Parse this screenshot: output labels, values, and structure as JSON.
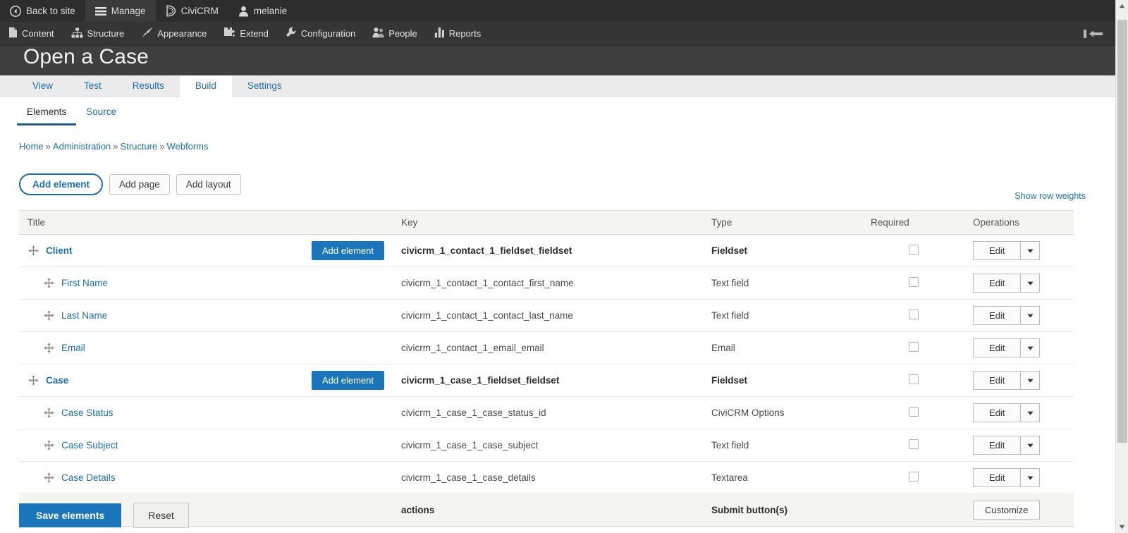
{
  "toolbar": {
    "tabs": [
      {
        "label": "Back to site",
        "icon": "back-arrow-icon",
        "active": false
      },
      {
        "label": "Manage",
        "icon": "hamburger-icon",
        "active": true
      },
      {
        "label": "CiviCRM",
        "icon": "civicrm-icon",
        "active": false
      },
      {
        "label": "melanie",
        "icon": "user-icon",
        "active": false
      }
    ],
    "tray_items": [
      {
        "label": "Content",
        "icon": "file-icon"
      },
      {
        "label": "Structure",
        "icon": "structure-icon"
      },
      {
        "label": "Appearance",
        "icon": "paintbrush-icon"
      },
      {
        "label": "Extend",
        "icon": "puzzle-icon"
      },
      {
        "label": "Configuration",
        "icon": "wrench-icon"
      },
      {
        "label": "People",
        "icon": "people-icon"
      },
      {
        "label": "Reports",
        "icon": "bar-chart-icon"
      }
    ],
    "collapse_icon": "collapse-toolbar-icon"
  },
  "page": {
    "title": "Open a Case"
  },
  "primary_tabs": [
    {
      "label": "View",
      "active": false
    },
    {
      "label": "Test",
      "active": false
    },
    {
      "label": "Results",
      "active": false
    },
    {
      "label": "Build",
      "active": true
    },
    {
      "label": "Settings",
      "active": false
    }
  ],
  "secondary_tabs": [
    {
      "label": "Elements",
      "active": true
    },
    {
      "label": "Source",
      "active": false
    }
  ],
  "breadcrumb": [
    {
      "label": "Home"
    },
    {
      "label": "Administration"
    },
    {
      "label": "Structure"
    },
    {
      "label": "Webforms"
    }
  ],
  "breadcrumb_separator": "»",
  "actions": {
    "add_element": "Add element",
    "add_page": "Add page",
    "add_layout": "Add layout",
    "show_row_weights": "Show row weights",
    "save_elements": "Save elements",
    "reset": "Reset"
  },
  "table": {
    "headers": [
      "Title",
      "Key",
      "Type",
      "Required",
      "Operations"
    ],
    "op_edit_label": "Edit",
    "op_customize_label": "Customize",
    "inline_add_label": "Add element",
    "rows": [
      {
        "title": "Client",
        "key": "civicrm_1_contact_1_fieldset_fieldset",
        "type": "Fieldset",
        "bold": true,
        "indent": false,
        "has_add_element": true,
        "required": false,
        "operation": "edit"
      },
      {
        "title": "First Name",
        "key": "civicrm_1_contact_1_contact_first_name",
        "type": "Text field",
        "bold": false,
        "indent": true,
        "has_add_element": false,
        "required": false,
        "operation": "edit"
      },
      {
        "title": "Last Name",
        "key": "civicrm_1_contact_1_contact_last_name",
        "type": "Text field",
        "bold": false,
        "indent": true,
        "has_add_element": false,
        "required": false,
        "operation": "edit"
      },
      {
        "title": "Email",
        "key": "civicrm_1_contact_1_email_email",
        "type": "Email",
        "bold": false,
        "indent": true,
        "has_add_element": false,
        "required": false,
        "operation": "edit"
      },
      {
        "title": "Case",
        "key": "civicrm_1_case_1_fieldset_fieldset",
        "type": "Fieldset",
        "bold": true,
        "indent": false,
        "has_add_element": true,
        "required": false,
        "operation": "edit"
      },
      {
        "title": "Case Status",
        "key": "civicrm_1_case_1_case_status_id",
        "type": "CiviCRM Options",
        "bold": false,
        "indent": true,
        "has_add_element": false,
        "required": false,
        "operation": "edit"
      },
      {
        "title": "Case Subject",
        "key": "civicrm_1_case_1_case_subject",
        "type": "Text field",
        "bold": false,
        "indent": true,
        "has_add_element": false,
        "required": false,
        "operation": "edit"
      },
      {
        "title": "Case Details",
        "key": "civicrm_1_case_1_case_details",
        "type": "Textarea",
        "bold": false,
        "indent": true,
        "has_add_element": false,
        "required": false,
        "operation": "edit"
      },
      {
        "title": "Submit button(s)",
        "key": "actions",
        "type": "Submit button(s)",
        "bold": true,
        "indent": false,
        "has_add_element": false,
        "required": null,
        "operation": "customize",
        "is_submit_row": true,
        "no_drag": true
      }
    ]
  },
  "colors": {
    "toolbar_bg": "#2d2d2d",
    "tray_bg": "#353535",
    "banner_bg": "#3f3f3f",
    "link_blue": "#1c6fad",
    "button_blue": "#1b75bb",
    "tab_bar_bg": "#ebebeb",
    "header_row_bg": "#f4f4f1"
  }
}
